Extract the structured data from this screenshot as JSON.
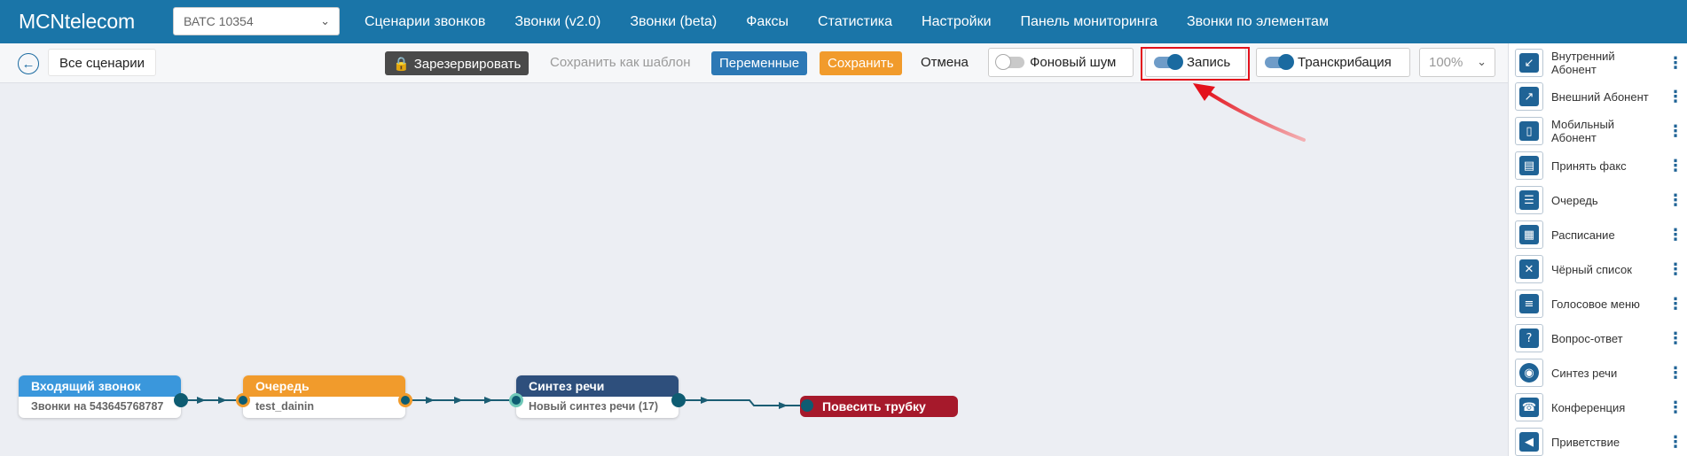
{
  "app": {
    "logo": "MCNtelecom"
  },
  "vats_select": {
    "value": "ВАТС 10354"
  },
  "nav": [
    "Сценарии звонков",
    "Звонки (v2.0)",
    "Звонки (beta)",
    "Факсы",
    "Статистика",
    "Настройки",
    "Панель мониторинга",
    "Звонки по элементам"
  ],
  "toolbar": {
    "all_scenarios": "Все сценарии",
    "reserve": "Зарезервировать",
    "save_template": "Сохранить как шаблон",
    "variables": "Переменные",
    "save": "Сохранить",
    "cancel": "Отмена",
    "bg_noise": "Фоновый шум",
    "bg_noise_on": false,
    "record": "Запись",
    "record_on": true,
    "transcription": "Транскрибация",
    "transcription_on": true,
    "zoom": "100%"
  },
  "palette": [
    {
      "label": "Внутренний Абонент",
      "icon": "internal-subscriber-icon"
    },
    {
      "label": "Внешний Абонент",
      "icon": "external-subscriber-icon"
    },
    {
      "label": "Мобильный Абонент",
      "icon": "mobile-subscriber-icon"
    },
    {
      "label": "Принять факс",
      "icon": "fax-icon"
    },
    {
      "label": "Очередь",
      "icon": "queue-icon"
    },
    {
      "label": "Расписание",
      "icon": "schedule-icon"
    },
    {
      "label": "Чёрный список",
      "icon": "blacklist-icon"
    },
    {
      "label": "Голосовое меню",
      "icon": "voice-menu-icon"
    },
    {
      "label": "Вопрос-ответ",
      "icon": "question-answer-icon"
    },
    {
      "label": "Синтез речи",
      "icon": "speech-synthesis-icon"
    },
    {
      "label": "Конференция",
      "icon": "conference-icon"
    },
    {
      "label": "Приветствие",
      "icon": "greeting-icon"
    }
  ],
  "nodes": {
    "incoming": {
      "title": "Входящий звонок",
      "body": "Звонки на 543645768787",
      "color": "#3a97dc"
    },
    "queue": {
      "title": "Очередь",
      "body": "test_dainin",
      "color": "#f19b2c"
    },
    "tts": {
      "title": "Синтез речи",
      "body": "Новый синтез речи (17)",
      "color": "#2e4f7c"
    },
    "hangup": {
      "title": "Повесить трубку",
      "color": "#a6192b"
    }
  },
  "colors": {
    "nav": "#1a75a8",
    "accent": "#2c78b5",
    "annotation": "#e3121c"
  }
}
